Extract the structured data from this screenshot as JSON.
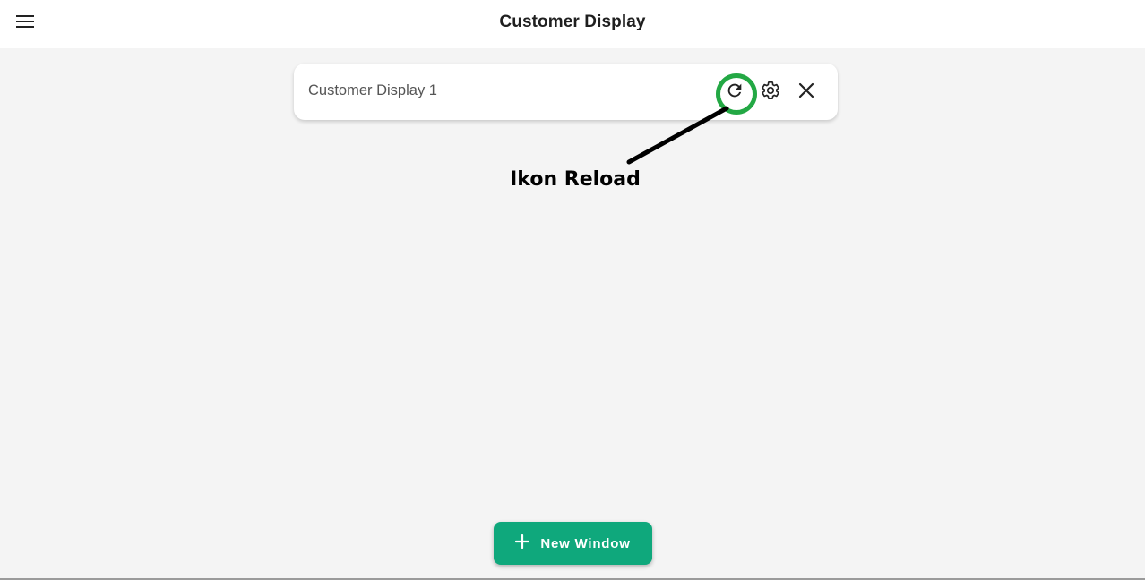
{
  "header": {
    "title": "Customer Display",
    "menu_icon": "menu-icon"
  },
  "display_card": {
    "name": "Customer Display 1",
    "actions": [
      {
        "icon": "reload-icon"
      },
      {
        "icon": "settings-gear-icon"
      },
      {
        "icon": "close-icon"
      }
    ]
  },
  "annotation": {
    "label": "Ikon Reload",
    "ring_color": "#23a844"
  },
  "footer": {
    "new_window_label": "New Window",
    "new_window_icon": "plus-icon",
    "button_color": "#0fa87c"
  }
}
